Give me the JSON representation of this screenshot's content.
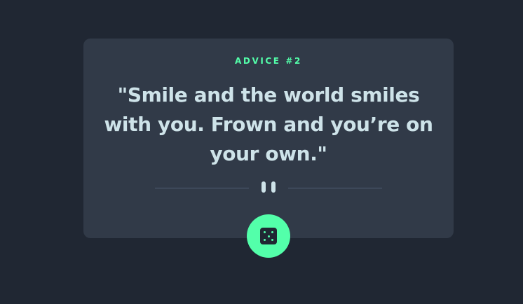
{
  "advice": {
    "id_label": "ADVICE #2",
    "quote": "\"Smile and the world smiles with you. Frown and you’re on your own.\""
  },
  "colors": {
    "background": "#202733",
    "card": "#313A48",
    "accent": "#53FFAA",
    "text": "#CEE3E9",
    "divider": "#4F5D74"
  },
  "icons": {
    "divider": "pause-icon",
    "button": "dice-icon"
  }
}
